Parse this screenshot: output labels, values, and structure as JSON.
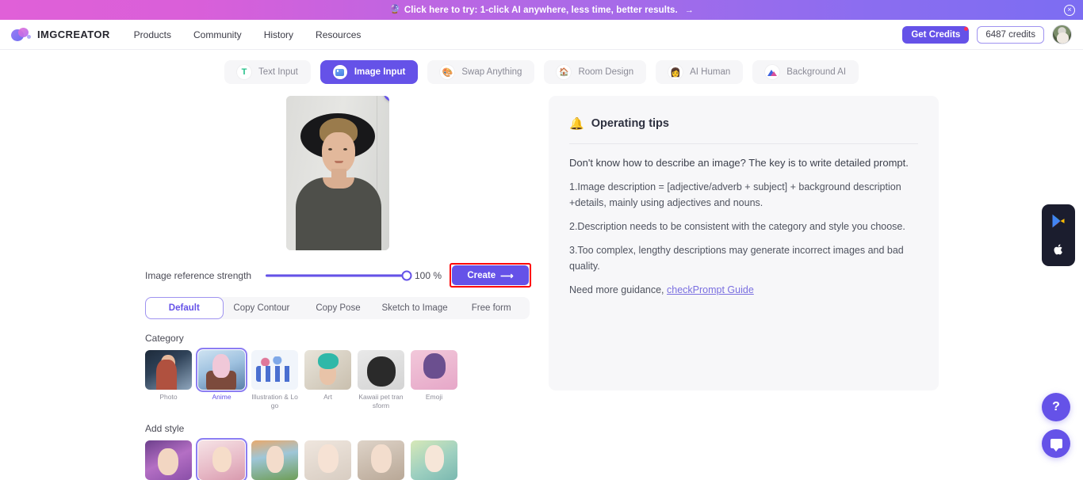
{
  "banner": {
    "icon": "sparkle-icon",
    "text": "Click here to try: 1-click AI anywhere, less time, better results.",
    "arrow": "→",
    "close": "×"
  },
  "nav": {
    "brand": "IMGCREATOR",
    "links": [
      "Products",
      "Community",
      "History",
      "Resources"
    ],
    "get_credits_label": "Get Credits",
    "credits_label": "6487 credits"
  },
  "mode_tabs": [
    {
      "label": "Text Input",
      "icon": "text-input-icon",
      "active": false
    },
    {
      "label": "Image Input",
      "icon": "image-input-icon",
      "active": true
    },
    {
      "label": "Swap Anything",
      "icon": "swap-anything-icon",
      "active": false
    },
    {
      "label": "Room Design",
      "icon": "room-design-icon",
      "active": false
    },
    {
      "label": "AI Human",
      "icon": "ai-human-icon",
      "active": false
    },
    {
      "label": "Background AI",
      "icon": "background-ai-icon",
      "active": false
    }
  ],
  "upload": {
    "close_label": "×",
    "alt": "uploaded-portrait-photo"
  },
  "strength": {
    "label": "Image reference strength",
    "value": "100 %",
    "percent": 100
  },
  "create": {
    "label": "Create",
    "arrow": "⟶",
    "highlight_color": "#ff0000"
  },
  "segmented": {
    "options": [
      "Default",
      "Copy Contour",
      "Copy Pose",
      "Sketch to Image",
      "Free form"
    ],
    "selected": "Default"
  },
  "category": {
    "title": "Category",
    "selected": "Anime",
    "items": [
      {
        "label": "Photo",
        "art": "t-photo"
      },
      {
        "label": "Anime",
        "art": "t-anime"
      },
      {
        "label": "Illustration & Logo",
        "art": "t-illus"
      },
      {
        "label": "Art",
        "art": "t-art"
      },
      {
        "label": "Kawaii pet transform",
        "art": "t-cat"
      },
      {
        "label": "Emoji",
        "art": "t-emoji"
      }
    ]
  },
  "add_style": {
    "title": "Add style",
    "selected_index": 1,
    "items": [
      {
        "label": "",
        "art": "s1"
      },
      {
        "label": "",
        "art": "s2"
      },
      {
        "label": "",
        "art": "s3"
      },
      {
        "label": "",
        "art": "s4"
      },
      {
        "label": "",
        "art": "s5"
      },
      {
        "label": "",
        "art": "s6"
      }
    ]
  },
  "tips": {
    "icon": "bell-icon",
    "title": "Operating tips",
    "lead": "Don't know how to describe an image? The key is to write detailed prompt.",
    "items": [
      "1.Image description = [adjective/adverb + subject] + background description +details, mainly using adjectives and nouns.",
      "2.Description needs to be consistent with the category and style you choose.",
      "3.Too complex, lengthy descriptions may generate incorrect images and bad quality."
    ],
    "footer_text": "Need more guidance, ",
    "footer_link": "checkPrompt Guide"
  },
  "floating": {
    "store": [
      {
        "name": "google-play-icon"
      },
      {
        "name": "apple-app-store-icon"
      }
    ],
    "help_label": "?",
    "chat_label": "chat-icon"
  },
  "colors": {
    "accent": "#6552e8",
    "accent_light": "#9f93f0",
    "banner_start": "#e060d8",
    "banner_end": "#7c6df2",
    "panel_bg": "#f7f7f9",
    "highlight": "#ff0000"
  }
}
